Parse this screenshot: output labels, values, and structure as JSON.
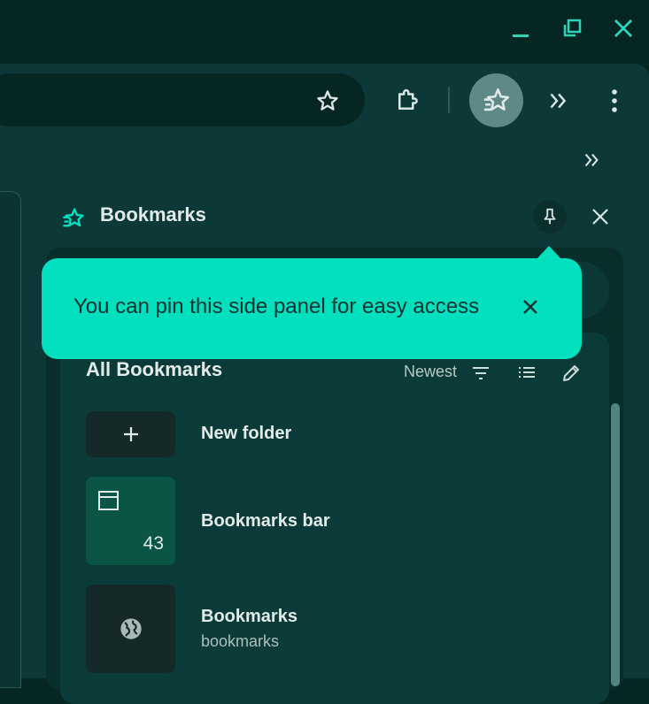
{
  "colors": {
    "accent": "#00dfbe",
    "frame": "#062624",
    "toolbar": "#0c3937",
    "text": "#e3ebe9"
  },
  "window_controls": {
    "minimize_icon": "minimize-icon",
    "restore_icon": "restore-icon",
    "close_icon": "close-icon"
  },
  "toolbar": {
    "bookmark_star_icon": "star-icon",
    "extensions_icon": "puzzle-icon",
    "bookmarks_panel_icon": "bookmarks-star-icon",
    "overflow_icon": "double-chevron-icon",
    "menu_icon": "kebab-menu-icon"
  },
  "side_panel": {
    "title": "Bookmarks",
    "pin_icon": "pin-icon",
    "close_icon": "close-icon"
  },
  "popup": {
    "text": "You can pin this side panel for easy access",
    "close_icon": "close-icon"
  },
  "bookmarks_list": {
    "title": "All Bookmarks",
    "sort_label": "Newest",
    "items": [
      {
        "label": "New folder",
        "icon": "plus-icon"
      },
      {
        "label": "Bookmarks bar",
        "count": "43",
        "icon": "bookmarks-bar-icon"
      },
      {
        "label": "Bookmarks",
        "sub": "bookmarks",
        "icon": "globe-icon"
      }
    ]
  }
}
